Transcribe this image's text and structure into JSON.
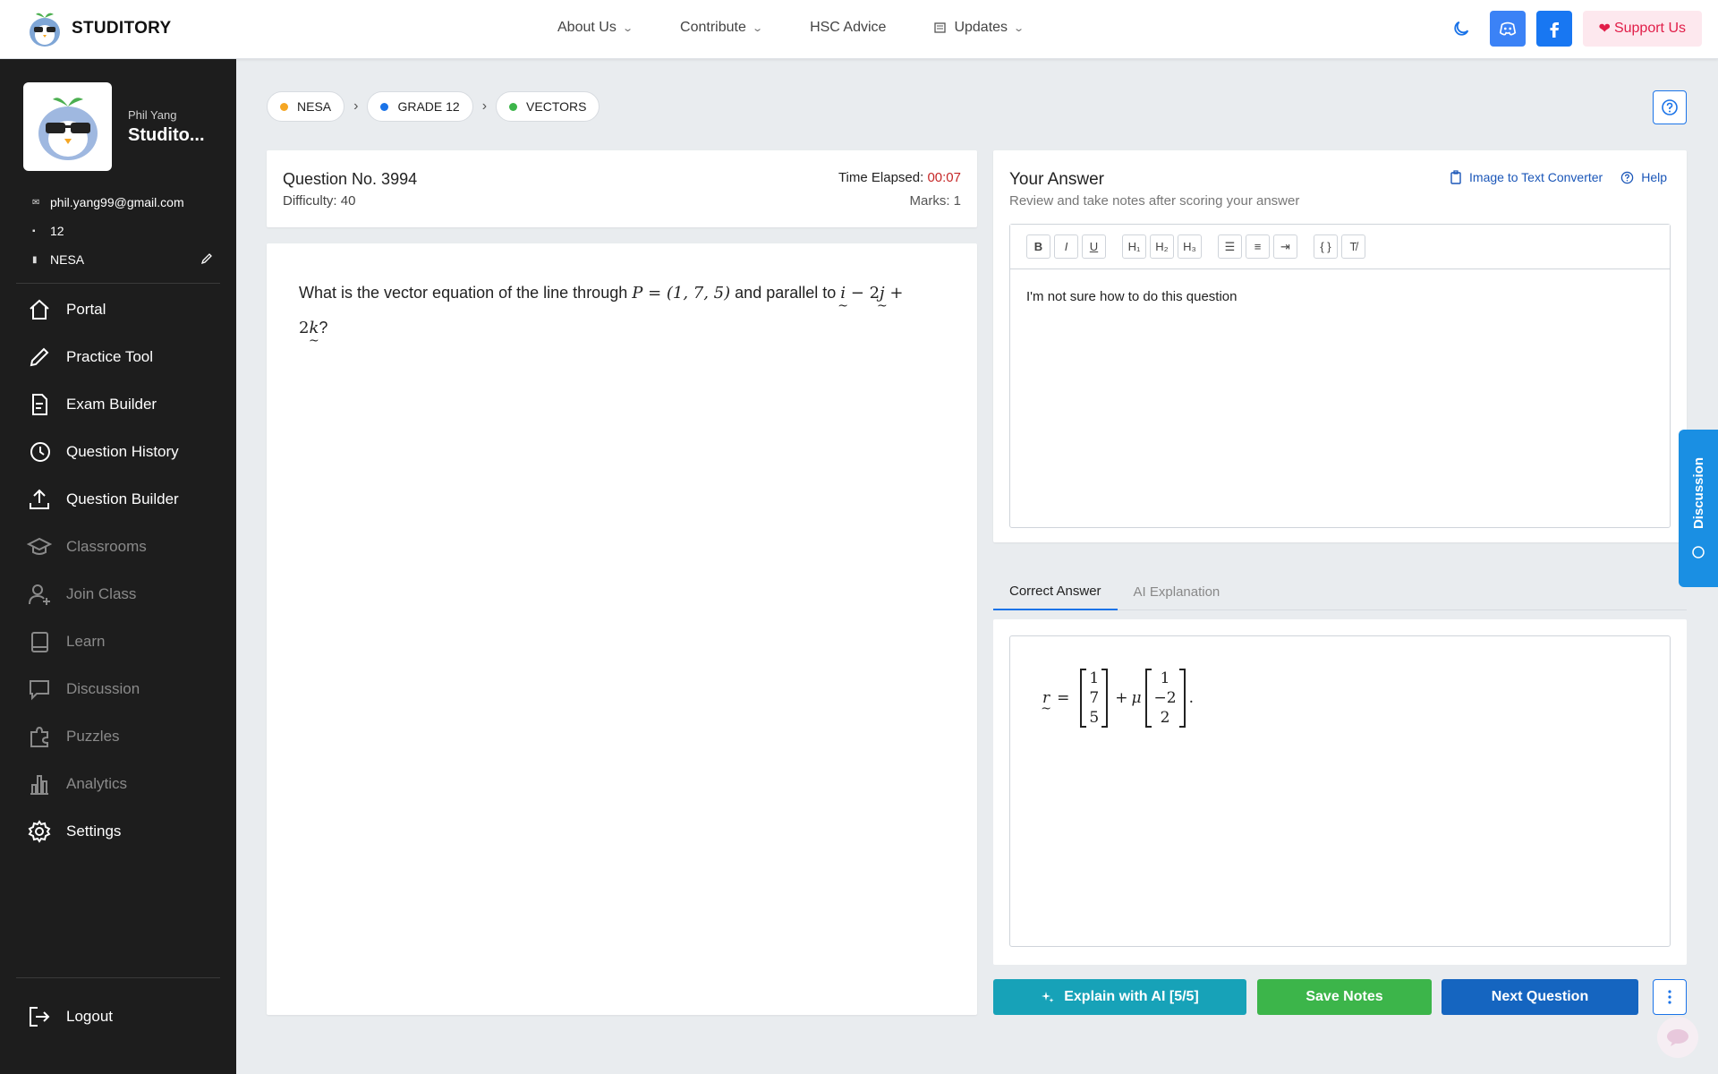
{
  "brand": {
    "name": "STUDITORY"
  },
  "nav": {
    "about": "About Us",
    "contribute": "Contribute",
    "hsc": "HSC Advice",
    "updates": "Updates",
    "support": "Support Us"
  },
  "profile": {
    "name": "Phil Yang",
    "username": "Studito...",
    "email": "phil.yang99@gmail.com",
    "grade": "12",
    "board": "NESA"
  },
  "menu": [
    {
      "label": "Portal",
      "icon": "home-icon"
    },
    {
      "label": "Practice Tool",
      "icon": "pencil-icon"
    },
    {
      "label": "Exam Builder",
      "icon": "document-icon"
    },
    {
      "label": "Question History",
      "icon": "history-icon"
    },
    {
      "label": "Question Builder",
      "icon": "upload-icon"
    },
    {
      "label": "Classrooms",
      "icon": "graduation-cap-icon"
    },
    {
      "label": "Join Class",
      "icon": "add-user-icon"
    },
    {
      "label": "Learn",
      "icon": "book-icon"
    },
    {
      "label": "Discussion",
      "icon": "chat-icon"
    },
    {
      "label": "Puzzles",
      "icon": "puzzle-icon"
    },
    {
      "label": "Analytics",
      "icon": "bar-chart-icon"
    },
    {
      "label": "Settings",
      "icon": "gear-icon"
    }
  ],
  "logout": "Logout",
  "breadcrumb": [
    {
      "label": "NESA",
      "color": "#f5a623"
    },
    {
      "label": "GRADE 12",
      "color": "#1a73e8"
    },
    {
      "label": "VECTORS",
      "color": "#3cb54a"
    }
  ],
  "question": {
    "number_label": "Question No. 3994",
    "difficulty_label": "Difficulty: 40",
    "time_label": "Time Elapsed: ",
    "time_value": "00:07",
    "marks_label": "Marks: 1",
    "text_before": "What is the vector equation of the line through ",
    "text_point": "P = (1, 7, 5)",
    "text_mid": " and parallel to ",
    "text_end": "?"
  },
  "answer": {
    "title": "Your Answer",
    "subtitle": "Review and take notes after scoring your answer",
    "converter_link": "Image to Text Converter",
    "help_link": "Help",
    "editor_text": "I'm not sure how to do this question"
  },
  "tabs": {
    "correct": "Correct Answer",
    "ai": "AI Explanation"
  },
  "correct_answer": {
    "lhs": "r",
    "v1": [
      "1",
      "7",
      "5"
    ],
    "param": "μ",
    "v2": [
      "1",
      "−2",
      "2"
    ]
  },
  "buttons": {
    "explain": "Explain with AI [5/5]",
    "save": "Save Notes",
    "next": "Next Question"
  },
  "discussion_tab": "Discussion",
  "colors": {
    "sidebar_bg": "#1d1d1d",
    "primary": "#1565c0",
    "teal": "#17a2b8",
    "green": "#3cb54a",
    "timer": "#c62828"
  }
}
